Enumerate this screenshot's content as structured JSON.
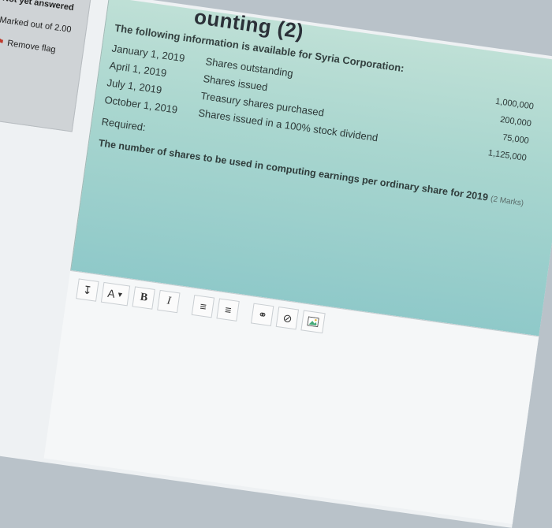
{
  "sidebar": {
    "status": "Not yet answered",
    "marks": "Marked out of 2.00",
    "flag_label": "Remove flag"
  },
  "question": {
    "title": "ounting (2)",
    "intro": "The following information is available for Syria Corporation:",
    "rows": [
      {
        "date": "January 1, 2019",
        "desc": "Shares outstanding",
        "amount": "1,000,000"
      },
      {
        "date": "April 1, 2019",
        "desc": "Shares issued",
        "amount": "200,000"
      },
      {
        "date": "July 1, 2019",
        "desc": "Treasury shares purchased",
        "amount": "75,000"
      },
      {
        "date": "October 1, 2019",
        "desc": "Shares issued in a 100% stock dividend",
        "amount": "1,125,000"
      }
    ],
    "required_label": "Required:",
    "required_text": "The number of shares to be used in computing earnings per ordinary share for 2019",
    "marks_note": "(2 Marks)"
  },
  "editor": {
    "font_label": "A",
    "bold_label": "B",
    "italic_label": "I"
  }
}
